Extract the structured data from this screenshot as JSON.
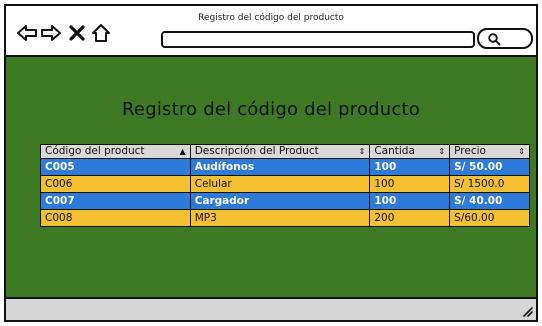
{
  "window": {
    "title": "Registro del código del producto"
  },
  "icons": {
    "back": "back-arrow-icon",
    "forward": "forward-arrow-icon",
    "close": "close-icon",
    "home": "home-icon",
    "search": "search-icon",
    "resize": "resize-grip-icon"
  },
  "page": {
    "heading": "Registro del código del producto"
  },
  "table": {
    "columns": [
      {
        "label": "Código del product",
        "sort": "▲"
      },
      {
        "label": "Descripción del Product",
        "sort": "⇕"
      },
      {
        "label": "Cantida",
        "sort": "⇕"
      },
      {
        "label": "Precio",
        "sort": "⇕"
      }
    ],
    "rows": [
      {
        "cells": [
          "C005",
          "Audífonos",
          "100",
          "S/ 50.00"
        ],
        "style": "blue"
      },
      {
        "cells": [
          "C006",
          "Celular",
          "100",
          "S/ 1500.0"
        ],
        "style": "yellow"
      },
      {
        "cells": [
          "C007",
          "Cargador",
          "100",
          "S/ 40.00"
        ],
        "style": "blue"
      },
      {
        "cells": [
          "C008",
          "MP3",
          "200",
          "S/60.00"
        ],
        "style": "yellow"
      }
    ]
  },
  "colors": {
    "content_bg": "#3e7a23",
    "row_blue": "#2e7ad8",
    "row_yellow": "#f2c030",
    "header_bg": "#d9d9d9"
  }
}
